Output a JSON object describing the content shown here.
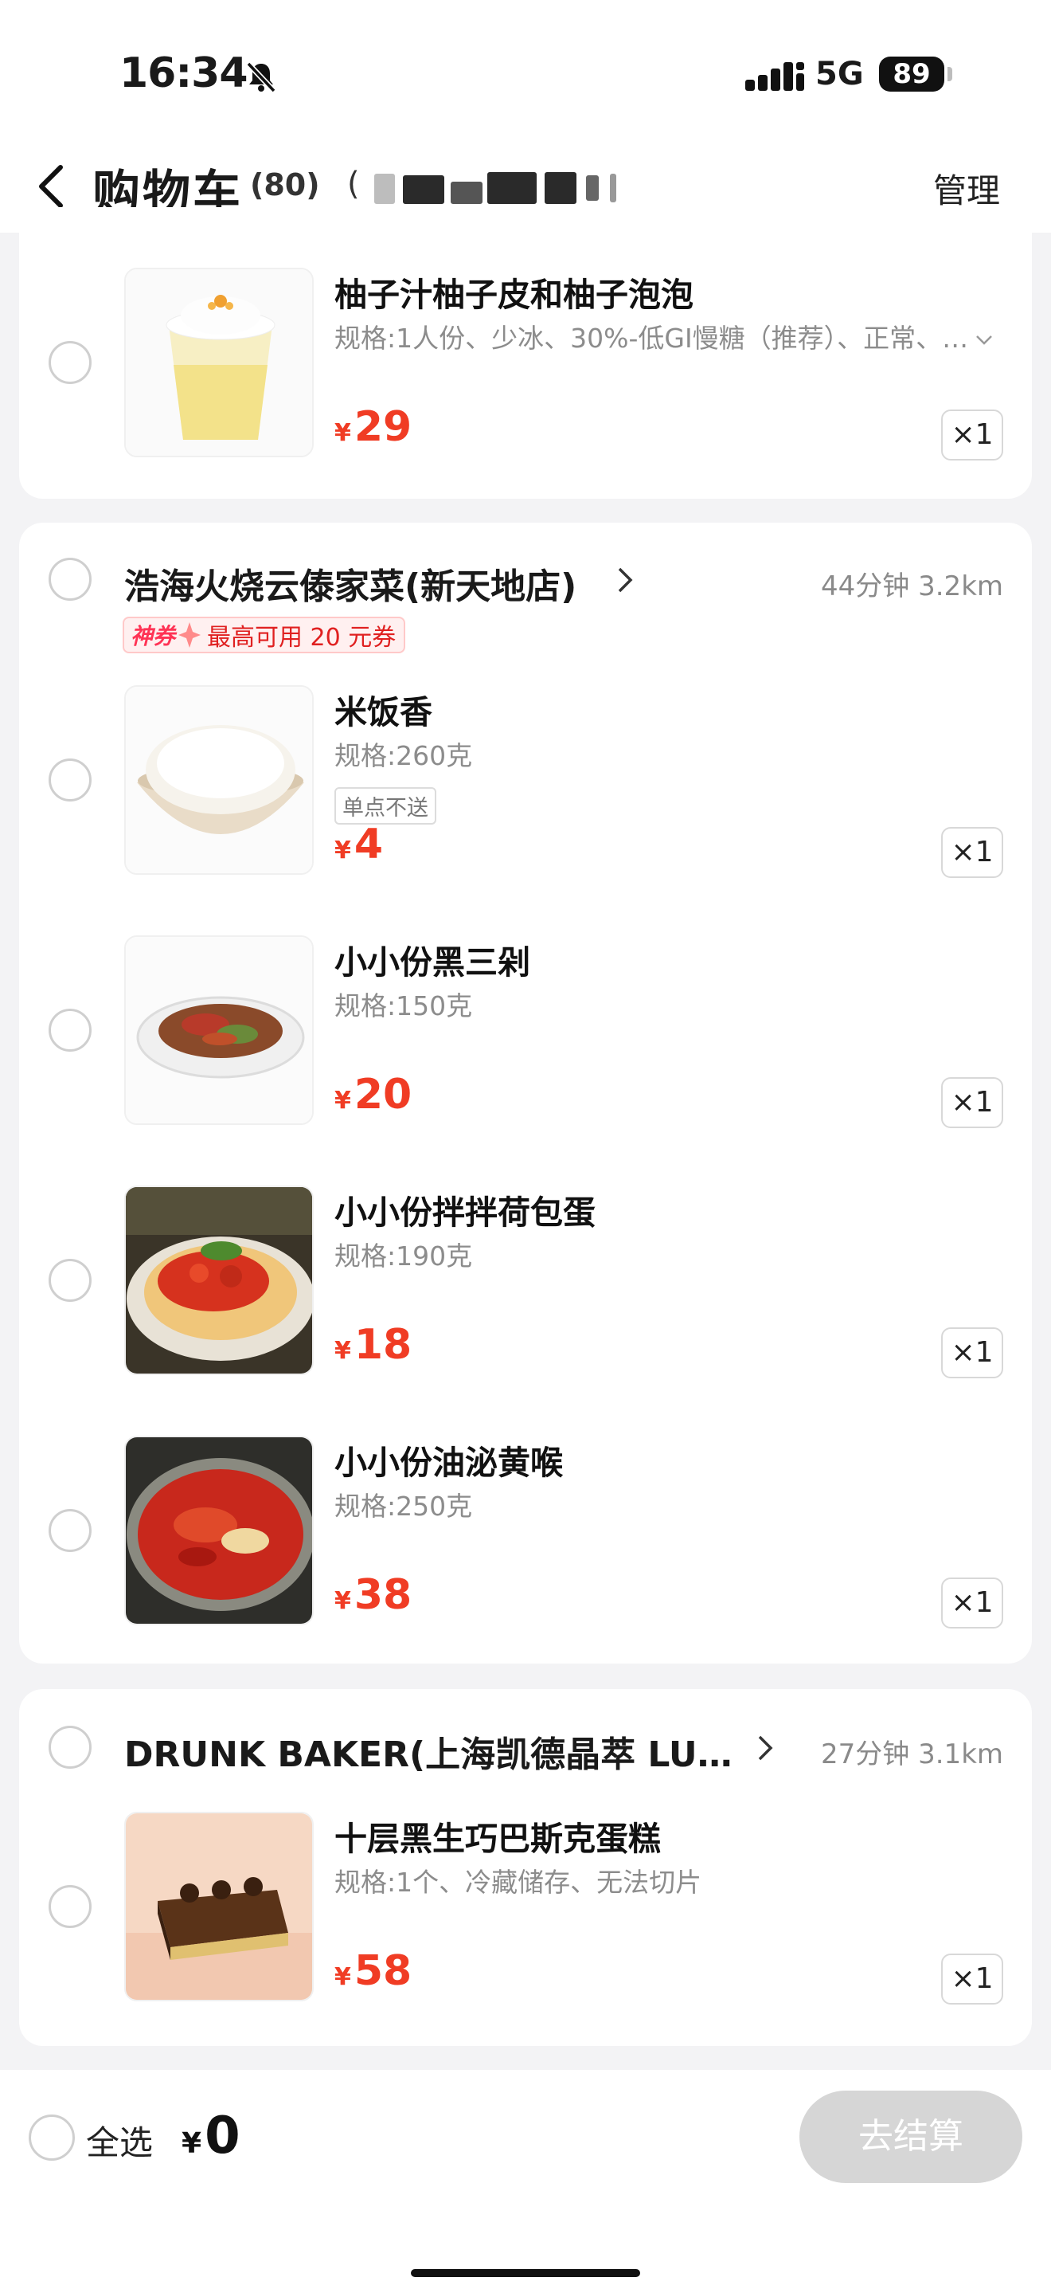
{
  "status_bar": {
    "time": "16:34",
    "network": "5G",
    "battery": "89"
  },
  "header": {
    "title": "购物车",
    "count": "(80)",
    "address_prefix": "(",
    "manage_label": "管理"
  },
  "stores": [
    {
      "name": "",
      "items": [
        {
          "name": "柚子汁柚子皮和柚子泡泡",
          "spec": "规格:1人份、少冰、30%-低GI慢糖（推荐）、正常、…",
          "price": "29",
          "qty": "×1"
        }
      ]
    },
    {
      "name": "浩海火烧云傣家菜(新天地店)",
      "meta": "44分钟  3.2km",
      "coupon": {
        "tag": "神券",
        "text": "最高可用 20 元券"
      },
      "items": [
        {
          "name": "米饭香",
          "spec": "规格:260克",
          "badge": "单点不送",
          "price": "4",
          "qty": "×1"
        },
        {
          "name": "小小份黑三剁",
          "spec": "规格:150克",
          "price": "20",
          "qty": "×1"
        },
        {
          "name": "小小份拌拌荷包蛋",
          "spec": "规格:190克",
          "price": "18",
          "qty": "×1"
        },
        {
          "name": "小小份油泌黄喉",
          "spec": "规格:250克",
          "price": "38",
          "qty": "×1"
        }
      ]
    },
    {
      "name": "DRUNK BAKER(上海凯德晶萃 LU…",
      "meta": "27分钟  3.1km",
      "items": [
        {
          "name": "十层黑生巧巴斯克蛋糕",
          "spec": "规格:1个、冷藏储存、无法切片",
          "price": "58",
          "qty": "×1"
        }
      ]
    }
  ],
  "currency": "¥",
  "bottom_bar": {
    "select_all_label": "全选",
    "total": "0",
    "checkout_label": "去结算"
  },
  "colors": {
    "price": "#f03c24",
    "checkout_disabled": "#d6d6d6",
    "page_bg": "#f3f3f5"
  }
}
